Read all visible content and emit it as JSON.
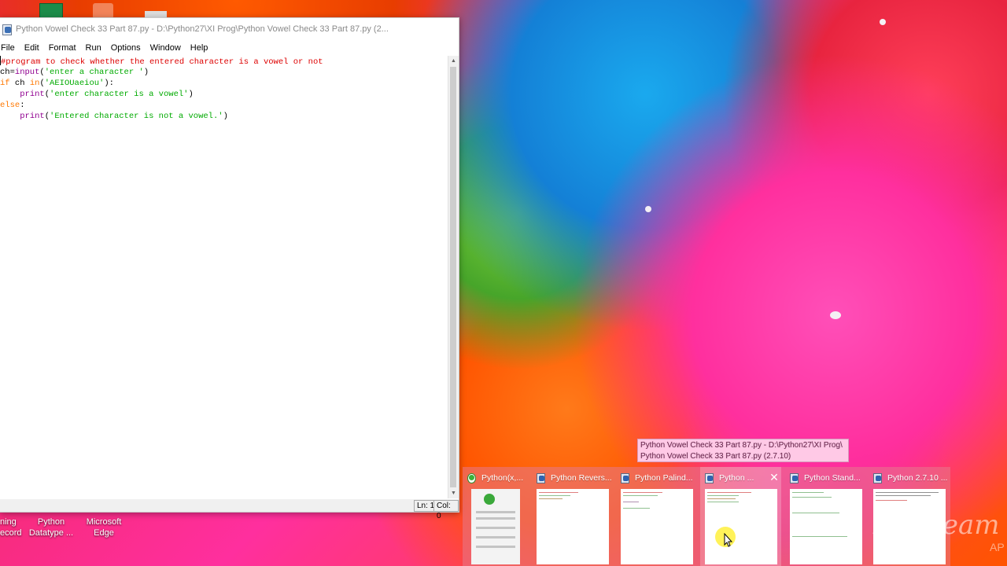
{
  "window": {
    "title": "Python Vowel Check 33 Part 87.py - D:\\Python27\\XI Prog\\Python Vowel Check 33 Part 87.py (2..."
  },
  "menu": [
    "File",
    "Edit",
    "Format",
    "Run",
    "Options",
    "Window",
    "Help"
  ],
  "code": {
    "line1": "#program to check whether the entered character is a vowel or not",
    "line2_var": "ch=",
    "line2_func": "input",
    "line2_open": "(",
    "line2_str": "'enter a character '",
    "line2_close": ")",
    "line3_kw": "if",
    "line3_mid": " ch ",
    "line3_kw2": "in",
    "line3_open": "(",
    "line3_str": "'AEIOUaeiou'",
    "line3_close": "):",
    "line4_indent": "    ",
    "line4_func": "print",
    "line4_open": "(",
    "line4_str": "'enter character is a vowel'",
    "line4_close": ")",
    "line5_kw": "else",
    "line5_colon": ":",
    "line6_indent": "    ",
    "line6_func": "print",
    "line6_open": "(",
    "line6_str": "'Entered character is not a vowel.'",
    "line6_close": ")"
  },
  "status": {
    "line": "Ln: 1",
    "col": "Col: 0"
  },
  "desktop_icons": [
    {
      "label_line1": "ning",
      "label_line2": "ecord"
    },
    {
      "label_line1": "Python",
      "label_line2": "Datatype ..."
    },
    {
      "label_line1": "Microsoft",
      "label_line2": "Edge"
    }
  ],
  "tooltip": {
    "line1": "Python Vowel Check 33 Part 87.py - D:\\Python27\\XI Prog\\",
    "line2": "Python Vowel Check 33 Part 87.py (2.7.10)"
  },
  "previews": [
    {
      "title": "Python(x,..."
    },
    {
      "title": "Python Revers..."
    },
    {
      "title": "Python Palind..."
    },
    {
      "title": "Python ..."
    },
    {
      "title": "Python Stand..."
    },
    {
      "title": "Python 2.7.10 ..."
    }
  ],
  "watermark": {
    "text": "Icecream",
    "sub": "AP"
  },
  "colors": {
    "comment": "#dd0000",
    "keyword": "#ff7700",
    "builtin": "#900090",
    "string": "#00aa00"
  }
}
